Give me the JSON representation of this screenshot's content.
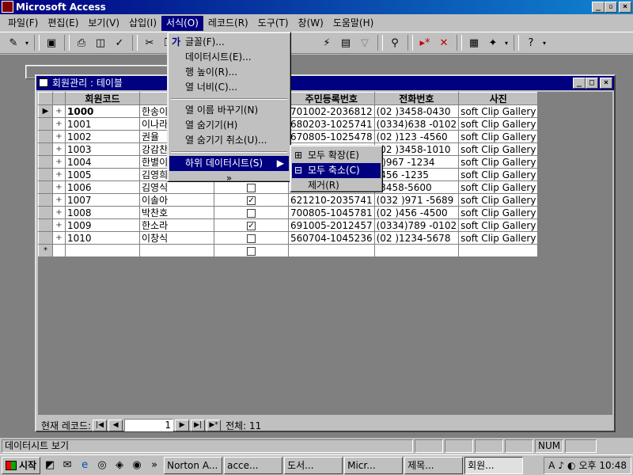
{
  "app": {
    "title": "Microsoft Access"
  },
  "menubar": {
    "items": [
      "파일(F)",
      "편집(E)",
      "보기(V)",
      "삽입(I)",
      "서식(O)",
      "레코드(R)",
      "도구(T)",
      "창(W)",
      "도움말(H)"
    ]
  },
  "format_menu": {
    "items": [
      "글꼴(F)...",
      "데이터시트(E)...",
      "행 높이(R)...",
      "열 너비(C)...",
      "열 이름 바꾸기(N)",
      "열 숨기기(H)",
      "열 숨기기 취소(U)...",
      "하위 데이터시트(S)",
      "»"
    ]
  },
  "subdatasheet_menu": {
    "items": [
      "모두 확장(E)",
      "모두 축소(C)",
      "제거(R)"
    ]
  },
  "table_window": {
    "title": "회원관리 : 테이블",
    "columns": [
      "회원코드",
      "",
      "",
      "주민등록번호",
      "전화번호",
      "사진"
    ],
    "rows": [
      {
        "code": "1000",
        "name": "한송이",
        "checked": false,
        "rrn": "701002-2036812",
        "phone": "(02 )3458-0430",
        "photo": "soft Clip Gallery"
      },
      {
        "code": "1001",
        "name": "이나라",
        "checked": false,
        "rrn": "680203-1025741",
        "phone": "(0334)638 -0102",
        "photo": "soft Clip Gallery"
      },
      {
        "code": "1002",
        "name": "권율",
        "checked": false,
        "rrn": "670805-1025478",
        "phone": "(02 )123 -4560",
        "photo": "soft Clip Gallery"
      },
      {
        "code": "1003",
        "name": "강감찬",
        "checked": false,
        "rrn": "",
        "phone": "(02 )3458-1010",
        "photo": "soft Clip Gallery"
      },
      {
        "code": "1004",
        "name": "한별이",
        "checked": false,
        "rrn": "",
        "phone": "4)967 -1234",
        "photo": "soft Clip Gallery"
      },
      {
        "code": "1005",
        "name": "김영희",
        "checked": false,
        "rrn": "",
        "phone": ")456 -1235",
        "photo": "soft Clip Gallery"
      },
      {
        "code": "1006",
        "name": "김영식",
        "checked": false,
        "rrn": "",
        "phone": ")3458-5600",
        "photo": "soft Clip Gallery"
      },
      {
        "code": "1007",
        "name": "이솔아",
        "checked": true,
        "rrn": "621210-2035741",
        "phone": "(032 )971 -5689",
        "photo": "soft Clip Gallery"
      },
      {
        "code": "1008",
        "name": "박찬호",
        "checked": false,
        "rrn": "700805-1045781",
        "phone": "(02 )456 -4500",
        "photo": "soft Clip Gallery"
      },
      {
        "code": "1009",
        "name": "한소라",
        "checked": true,
        "rrn": "691005-2012457",
        "phone": "(0334)789 -0102",
        "photo": "soft Clip Gallery"
      },
      {
        "code": "1010",
        "name": "이창식",
        "checked": false,
        "rrn": "560704-1045236",
        "phone": "(02 )1234-5678",
        "photo": "soft Clip Gallery"
      }
    ],
    "new_row_marker": "*",
    "current_marker": "▶",
    "expand_marker": "+"
  },
  "record_nav": {
    "label": "현재 레코드:",
    "current": "1",
    "total_label": "전체: 11"
  },
  "statusbar": {
    "text": "데이터시트 보기",
    "num": "NUM"
  },
  "taskbar": {
    "start": "시작",
    "more": "»",
    "buttons": [
      "Norton A...",
      "acce...",
      "도서...",
      "Micr...",
      "제목...",
      "회원..."
    ],
    "clock": "오후 10:48"
  }
}
